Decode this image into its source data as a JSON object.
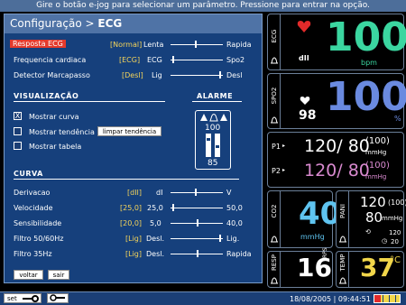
{
  "topbar": {
    "message": "Gire o botão e-jog para selecionar um parâmetro. Pressione para entrar na opção."
  },
  "config": {
    "title_prefix": "Configuração > ",
    "title_bold": "ECG",
    "rows": [
      {
        "label": "Resposta ECG",
        "value": "[Normal]",
        "left": "Lenta",
        "right": "Rapida"
      },
      {
        "label": "Frequencia cardiaca",
        "value": "[ECG]",
        "left": "ECG",
        "right": "Spo2"
      },
      {
        "label": "Detector Marcapasso",
        "value": "[Desl]",
        "left": "Lig",
        "right": "Desl"
      }
    ],
    "visual_title": "VISUALIZAÇÃO",
    "alarm_title": "ALARME",
    "checkboxes": [
      {
        "label": "Mostrar curva",
        "mark": "X"
      },
      {
        "label": "Mostrar tendência",
        "mark": ""
      },
      {
        "label": "Mostrar tabela",
        "mark": ""
      }
    ],
    "clear_trend": "limpar tendência",
    "alarm": {
      "high": "100",
      "low": "85"
    },
    "curve_title": "CURVA",
    "curve_rows": [
      {
        "label": "Derivacao",
        "value": "[dII]",
        "left": "dI",
        "right": "V"
      },
      {
        "label": "Velocidade",
        "value": "[25,0]",
        "left": "25,0",
        "right": "50,0"
      },
      {
        "label": "Sensibilidade",
        "value": "[20,0]",
        "left": "5,0",
        "right": "40,0"
      },
      {
        "label": "Filtro 50/60Hz",
        "value": "[Lig]",
        "left": "Desl.",
        "right": "Lig."
      },
      {
        "label": "Filtro 35Hz",
        "value": "[Lig]",
        "left": "Desl.",
        "right": "Rapida"
      }
    ],
    "back_label": "voltar",
    "exit_label": "sair"
  },
  "ecg": {
    "label": "ECG",
    "value": "100",
    "unit": "bpm",
    "lead": "dII",
    "color": "#3bd6a0"
  },
  "spo2": {
    "label": "SPO2",
    "value": "100",
    "unit": "%",
    "pulse": "98",
    "color": "#6a8ae0"
  },
  "pressure": {
    "p1": {
      "label": "P1",
      "sys": "120",
      "dia": "80",
      "mean": "(100)",
      "unit": "mmHg",
      "color": "#ffffff"
    },
    "p2": {
      "label": "P2",
      "sys": "120",
      "dia": "80",
      "mean": "(100)",
      "unit": "mmHg",
      "color": "#d98ad0"
    }
  },
  "co2": {
    "label": "CO2",
    "value": "40",
    "unit": "mmHg",
    "color": "#5fc4f0"
  },
  "pani": {
    "label": "PANI",
    "sys": "120",
    "mean": "(100)",
    "dia": "80",
    "unit": "mmHg",
    "interval": "120",
    "time": "20"
  },
  "resp": {
    "label": "RESP",
    "value": "16",
    "unit": "RPS"
  },
  "temp": {
    "label": "TEMP",
    "value": "37",
    "unit": "°C",
    "color": "#f1d64a"
  },
  "bottom": {
    "set_label": "set",
    "datetime": "18/08/2005 | 09:44:51"
  }
}
